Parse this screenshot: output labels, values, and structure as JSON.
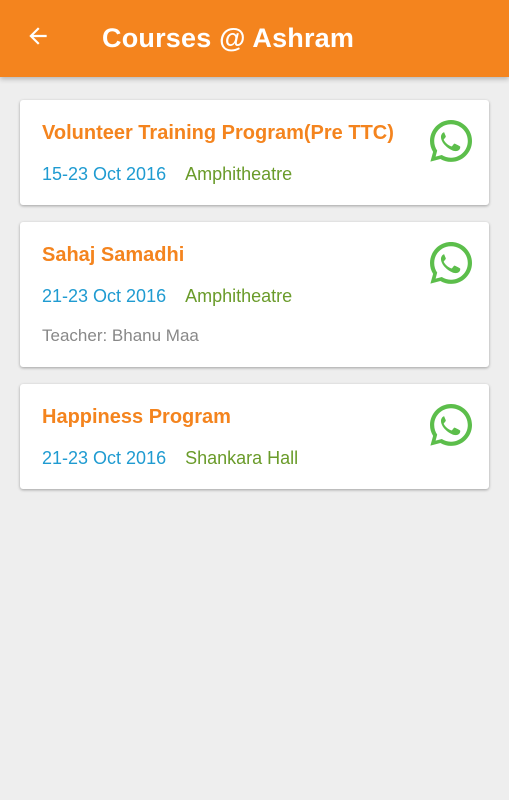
{
  "app_bar": {
    "title": "Courses @ Ashram",
    "accent_color": "#f4841e",
    "back_icon": "arrow-left-icon"
  },
  "courses": [
    {
      "title": "Volunteer Training Program(Pre TTC)",
      "date": "15-23 Oct 2016",
      "venue": "Amphitheatre",
      "share_icon": "whatsapp-icon"
    },
    {
      "title": "Sahaj Samadhi",
      "date": "21-23 Oct 2016",
      "venue": "Amphitheatre",
      "teacher": "Teacher: Bhanu Maa",
      "share_icon": "whatsapp-icon"
    },
    {
      "title": "Happiness Program",
      "date": "21-23 Oct 2016",
      "venue": "Shankara Hall",
      "share_icon": "whatsapp-icon"
    }
  ],
  "colors": {
    "title": "#f4841e",
    "date": "#1f9bd1",
    "venue": "#6a9b2a",
    "teacher": "#888888",
    "whatsapp": "#5cbe4b"
  }
}
